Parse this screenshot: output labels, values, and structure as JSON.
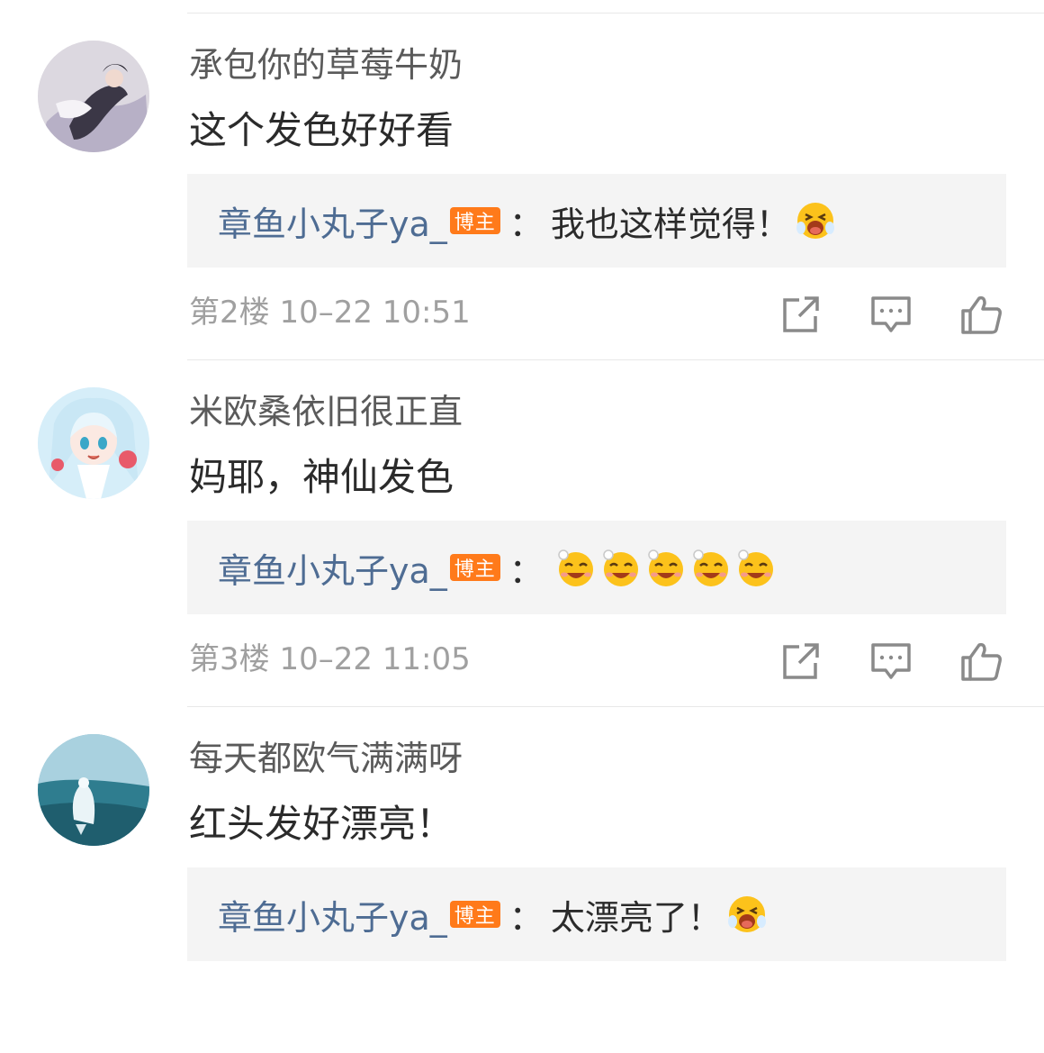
{
  "comments": [
    {
      "username": "承包你的草莓牛奶",
      "content": "这个发色好好看",
      "reply": {
        "author": "章鱼小丸子ya_",
        "badge": "博主",
        "separator": "：",
        "text": "我也这样觉得！",
        "emojis": [
          "crying-laugh-emoji"
        ]
      },
      "meta": "第2楼 10–22 10:51",
      "avatar_icon": "avatar-cosplay-photo"
    },
    {
      "username": "米欧桑依旧很正直",
      "content": "妈耶，神仙发色",
      "reply": {
        "author": "章鱼小丸子ya_",
        "badge": "博主",
        "separator": "：",
        "text": "",
        "emojis": [
          "sweat-smile-emoji",
          "sweat-smile-emoji",
          "sweat-smile-emoji",
          "sweat-smile-emoji",
          "sweat-smile-emoji"
        ]
      },
      "meta": "第3楼 10–22 11:05",
      "avatar_icon": "avatar-anime-girl"
    },
    {
      "username": "每天都欧气满满呀",
      "content": "红头发好漂亮！",
      "reply": {
        "author": "章鱼小丸子ya_",
        "badge": "博主",
        "separator": "：",
        "text": "太漂亮了！",
        "emojis": [
          "crying-laugh-emoji"
        ]
      },
      "meta": "",
      "avatar_icon": "avatar-sky-game"
    }
  ],
  "action_icons": [
    "share-icon",
    "comment-icon",
    "like-icon"
  ],
  "colors": {
    "reply_author": "#4e6c93",
    "badge_bg": "#ff7a1a",
    "reply_bg": "#f4f4f4",
    "meta_text": "#a0a0a0"
  }
}
